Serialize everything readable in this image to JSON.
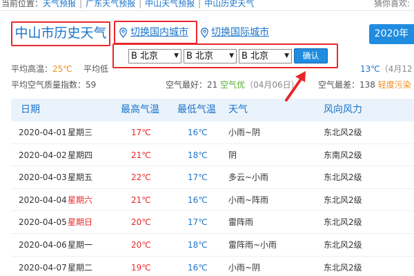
{
  "breadcrumb": {
    "prefix": "当前位置：",
    "items": [
      "天气预报",
      "广东天气预报",
      "中山天气预报",
      "中山历史天气"
    ],
    "guess": "猜你喜欢:"
  },
  "header": {
    "city_title": "中山市历史天气",
    "switch_domestic": "切换国内城市",
    "switch_international": "切换国际城市",
    "year_button": "2020年"
  },
  "popup": {
    "selects": [
      "B 北京",
      "B 北京",
      "B 北京"
    ],
    "confirm_label": "确认"
  },
  "stats": {
    "avg_high_label": "平均高温：",
    "avg_high_value": "25℃",
    "avg_low_label": "平均低",
    "min_right_value": "13℃",
    "min_right_date": "（4月12",
    "aqi_label": "平均空气质量指数：",
    "aqi_value": "59",
    "best_label": "空气最好：",
    "best_value": "21",
    "best_level": "空气优",
    "best_date": "（04月06日）",
    "worst_label": "空气最差：",
    "worst_value": "138",
    "worst_level": "轻度污染"
  },
  "table": {
    "headers": [
      "日期",
      "最高气温",
      "最低气温",
      "天气",
      "风向风力"
    ],
    "rows": [
      {
        "date": "2020-04-01",
        "weekday": "星期三",
        "high": "17℃",
        "low": "16℃",
        "weather": "小雨~阴",
        "wind": "东北风2级",
        "weekend": false
      },
      {
        "date": "2020-04-02",
        "weekday": "星期四",
        "high": "21℃",
        "low": "18℃",
        "weather": "阴",
        "wind": "东南风2级",
        "weekend": false
      },
      {
        "date": "2020-04-03",
        "weekday": "星期五",
        "high": "22℃",
        "low": "17℃",
        "weather": "多云~小雨",
        "wind": "东北风2级",
        "weekend": false
      },
      {
        "date": "2020-04-04",
        "weekday": "星期六",
        "high": "21℃",
        "low": "16℃",
        "weather": "小雨~阵雨",
        "wind": "东北风2级",
        "weekend": true
      },
      {
        "date": "2020-04-05",
        "weekday": "星期日",
        "high": "20℃",
        "low": "17℃",
        "weather": "雷阵雨",
        "wind": "东北风2级",
        "weekend": true
      },
      {
        "date": "2020-04-06",
        "weekday": "星期一",
        "high": "20℃",
        "low": "18℃",
        "weather": "雷阵雨~小雨",
        "wind": "东北风2级",
        "weekend": false
      },
      {
        "date": "2020-04-07",
        "weekday": "星期二",
        "high": "19℃",
        "low": "16℃",
        "weather": "小雨~阴",
        "wind": "东北风2级",
        "weekend": false
      }
    ]
  },
  "colors": {
    "link_blue": "#1a73c9",
    "highlight_red": "#e8262a",
    "button_blue": "#1f8ce0",
    "header_bg": "#eaf3fb",
    "temp_orange": "#f08c19",
    "air_green": "#52b02e"
  },
  "icons": {
    "pin": "location-pin-icon",
    "arrow": "red-arrow-icon",
    "dropdown": "caret-down-icon"
  }
}
